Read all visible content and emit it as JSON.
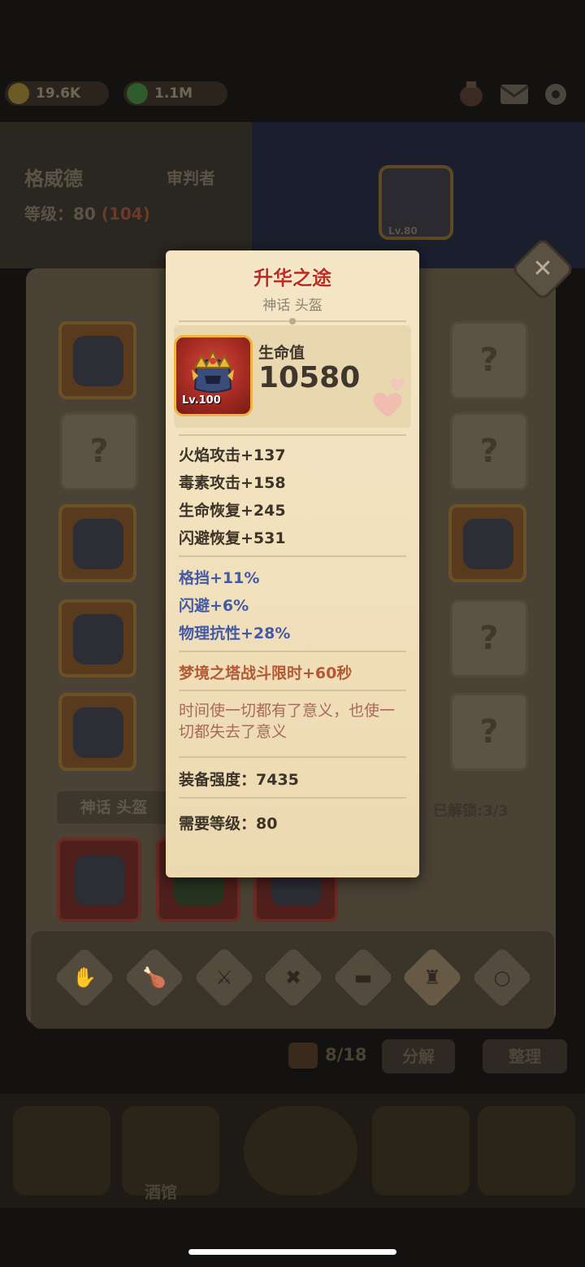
{
  "resources": {
    "coins": "19.6K",
    "gems": "1.1M"
  },
  "hero": {
    "name": "格威德",
    "role": "审判者",
    "level_label": "等级：80",
    "level_bonus": "(104)"
  },
  "stage_badge": "Lv.80",
  "inventory": {
    "section_label": "神话 头盔",
    "unlocked_label": "已解锁:3/3",
    "empty_slot_symbol": "?",
    "bag_count": "8/18",
    "decompose_label": "分解",
    "organize_label": "整理"
  },
  "nav": {
    "tavern_label": "酒馆"
  },
  "tooltip": {
    "title": "升华之途",
    "subtitle": "神话 头盔",
    "item_level": "Lv.100",
    "primary_stat_name": "生命值",
    "primary_stat_value": "10580",
    "base_stats": [
      "火焰攻击+137",
      "毒素攻击+158",
      "生命恢复+245",
      "闪避恢复+531"
    ],
    "bonus_stats": [
      "格挡+11%",
      "闪避+6%",
      "物理抗性+28%"
    ],
    "special_effect": "梦境之塔战斗限时+60秒",
    "lore": "时间使一切都有了意义，也使一切都失去了意义",
    "gear_score": "装备强度：7435",
    "required_level": "需要等级：80"
  },
  "colors": {
    "title_red": "#c02e22",
    "bonus_blue": "#445aa5",
    "special_brown": "#b35934",
    "lore_text": "#a9695a",
    "parchment": "#f0dfba"
  },
  "icons": [
    "coin-icon",
    "gem-icon",
    "potion-icon",
    "mail-icon",
    "gear-icon",
    "close-icon",
    "bag-icon",
    "hearts-icon"
  ]
}
